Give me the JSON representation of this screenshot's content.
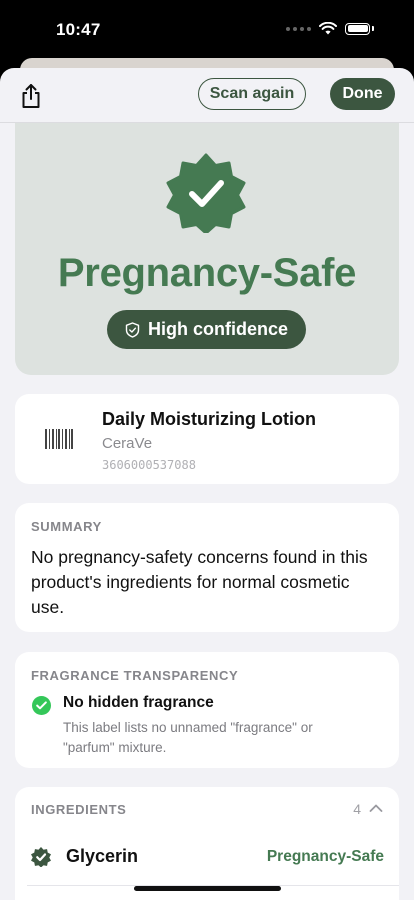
{
  "status_bar": {
    "time": "10:47"
  },
  "toolbar": {
    "scan_again_label": "Scan again",
    "done_label": "Done",
    "share_icon": "share-icon"
  },
  "result": {
    "verdict": "Pregnancy-Safe",
    "confidence": "High confidence",
    "accent": "#457a52",
    "dark_accent": "#3c5640"
  },
  "product": {
    "name": "Daily Moisturizing Lotion",
    "brand": "CeraVe",
    "barcode": "3606000537088"
  },
  "summary": {
    "label": "SUMMARY",
    "text": "No pregnancy-safety concerns found in this product's ingredients for normal cosmetic use."
  },
  "fragrance": {
    "label": "FRAGRANCE TRANSPARENCY",
    "title": "No hidden fragrance",
    "description": "This label lists no unnamed \"fragrance\" or \"parfum\" mixture."
  },
  "ingredients": {
    "label": "INGREDIENTS",
    "count": "4",
    "items": [
      {
        "name": "Glycerin",
        "verdict": "Pregnancy-Safe"
      }
    ]
  }
}
